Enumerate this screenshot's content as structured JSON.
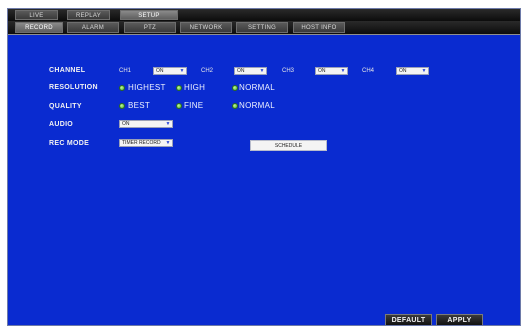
{
  "tabs": [
    {
      "label": "LIVE",
      "active": false
    },
    {
      "label": "REPLAY",
      "active": false
    },
    {
      "label": "SETUP",
      "active": true
    }
  ],
  "subtabs": [
    {
      "label": "RECORD",
      "active": true
    },
    {
      "label": "ALARM",
      "active": false
    },
    {
      "label": "PTZ",
      "active": false
    },
    {
      "label": "NETWORK",
      "active": false
    },
    {
      "label": "SETTING",
      "active": false
    },
    {
      "label": "HOST INFO",
      "active": false
    }
  ],
  "form": {
    "channel_label": "CHANNEL",
    "channels": [
      {
        "name": "CH1",
        "value": "ON"
      },
      {
        "name": "CH2",
        "value": "ON"
      },
      {
        "name": "CH3",
        "value": "ON"
      },
      {
        "name": "CH4",
        "value": "ON"
      }
    ],
    "resolution_label": "RESOLUTION",
    "resolution_options": [
      "HIGHEST",
      "HIGH",
      "NORMAL"
    ],
    "quality_label": "QUALITY",
    "quality_options": [
      "BEST",
      "FINE",
      "NORMAL"
    ],
    "audio_label": "AUDIO",
    "audio_value": "ON",
    "recmode_label": "REC MODE",
    "recmode_value": "TIMER RECORD",
    "schedule_label": "SCHEDULE"
  },
  "buttons": {
    "default": "DEFAULT",
    "apply": "APPLY"
  },
  "colors": {
    "background": "#0a2bd0",
    "tabbar": "#1a1a1a",
    "radio_on": "#3fa22a"
  }
}
